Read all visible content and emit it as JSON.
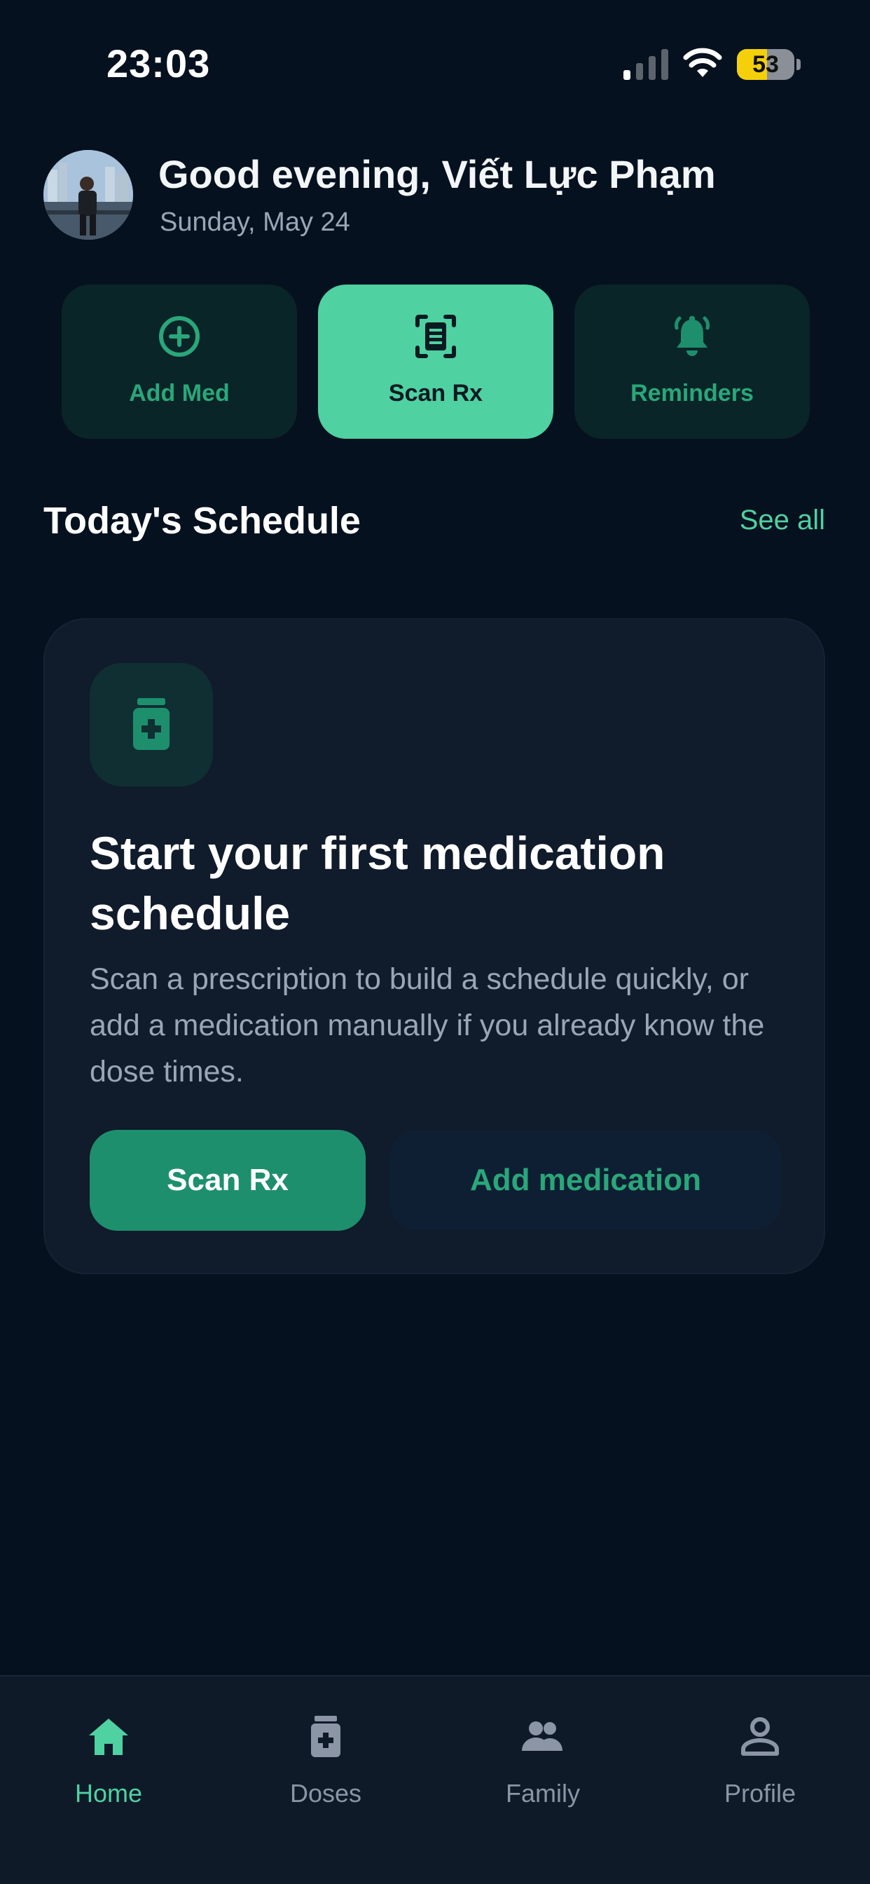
{
  "status_bar": {
    "time": "23:03",
    "battery_level": "53",
    "battery_fraction": 0.53
  },
  "header": {
    "greeting": "Good evening, Viết Lực Phạm",
    "date": "Sunday, May 24"
  },
  "quick_actions": [
    {
      "label": "Add Med",
      "icon": "plus-circle-icon"
    },
    {
      "label": "Scan Rx",
      "icon": "scan-document-icon"
    },
    {
      "label": "Reminders",
      "icon": "bell-ringing-icon"
    }
  ],
  "schedule": {
    "title": "Today's Schedule",
    "see_all_label": "See all"
  },
  "empty_state": {
    "icon": "medication-bottle-icon",
    "title": "Start your first medication schedule",
    "description": "Scan a prescription to build a schedule quickly, or add a medication manually if you already know the dose times.",
    "primary_button": "Scan Rx",
    "secondary_button": "Add medication"
  },
  "tab_bar": {
    "active": "Home",
    "tabs": [
      {
        "label": "Home",
        "icon": "home-icon"
      },
      {
        "label": "Doses",
        "icon": "pill-bottle-icon"
      },
      {
        "label": "Family",
        "icon": "people-icon"
      },
      {
        "label": "Profile",
        "icon": "person-icon"
      }
    ]
  },
  "colors": {
    "background": "#06111f",
    "accent": "#4fd1a1",
    "accent_dark": "#1e8f6d",
    "card": "#101b2b",
    "muted_text": "#9aa6b6"
  }
}
